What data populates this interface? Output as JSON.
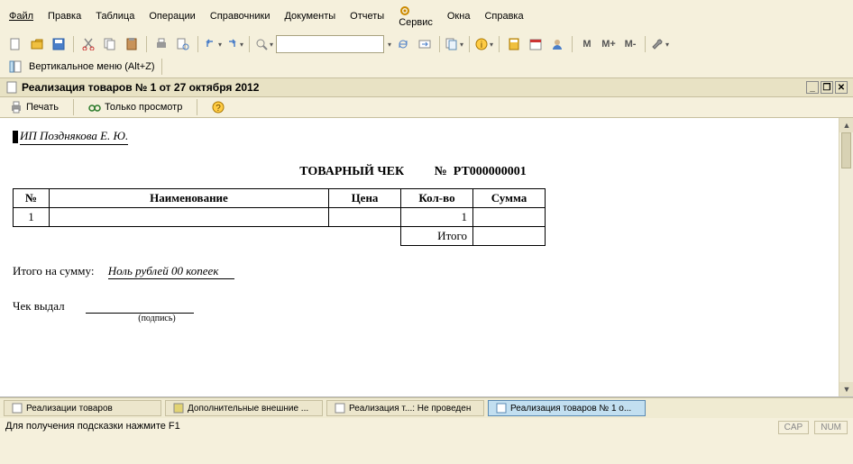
{
  "menu": {
    "file": "Файл",
    "edit": "Правка",
    "table": "Таблица",
    "ops": "Операции",
    "ref": "Справочники",
    "docs": "Документы",
    "reports": "Отчеты",
    "service": "Сервис",
    "windows": "Окна",
    "help": "Справка"
  },
  "toolbar2": {
    "vert_menu": "Вертикальное меню (Alt+Z)"
  },
  "mem": {
    "m": "M",
    "mp": "M+",
    "mm": "M-"
  },
  "window": {
    "title": "Реализация товаров № 1 от 27 октября 2012"
  },
  "doc_toolbar": {
    "print": "Печать",
    "view_only": "Только просмотр"
  },
  "receipt": {
    "issuer": "ИП Позднякова Е. Ю.",
    "heading": "ТОВАРНЫЙ ЧЕК",
    "num_label": "№",
    "num_value": "РТ000000001",
    "cols": {
      "no": "№",
      "name": "Наименование",
      "price": "Цена",
      "qty": "Кол-во",
      "sum": "Сумма"
    },
    "rows": [
      {
        "no": "1",
        "name": "",
        "price": "",
        "qty": "1",
        "sum": ""
      }
    ],
    "total_label": "Итого",
    "sum_label": "Итого на сумму:",
    "sum_words": "Ноль рублей 00 копеек",
    "sign_label": "Чек выдал",
    "sign_caption": "(подпись)"
  },
  "tabs": [
    {
      "label": "Реализации товаров",
      "active": false
    },
    {
      "label": "Дополнительные внешние ...",
      "active": false
    },
    {
      "label": "Реализация т...: Не проведен",
      "active": false
    },
    {
      "label": "Реализация товаров № 1 о...",
      "active": true
    }
  ],
  "status": {
    "hint": "Для получения подсказки нажмите F1",
    "cap": "CAP",
    "num": "NUM"
  }
}
